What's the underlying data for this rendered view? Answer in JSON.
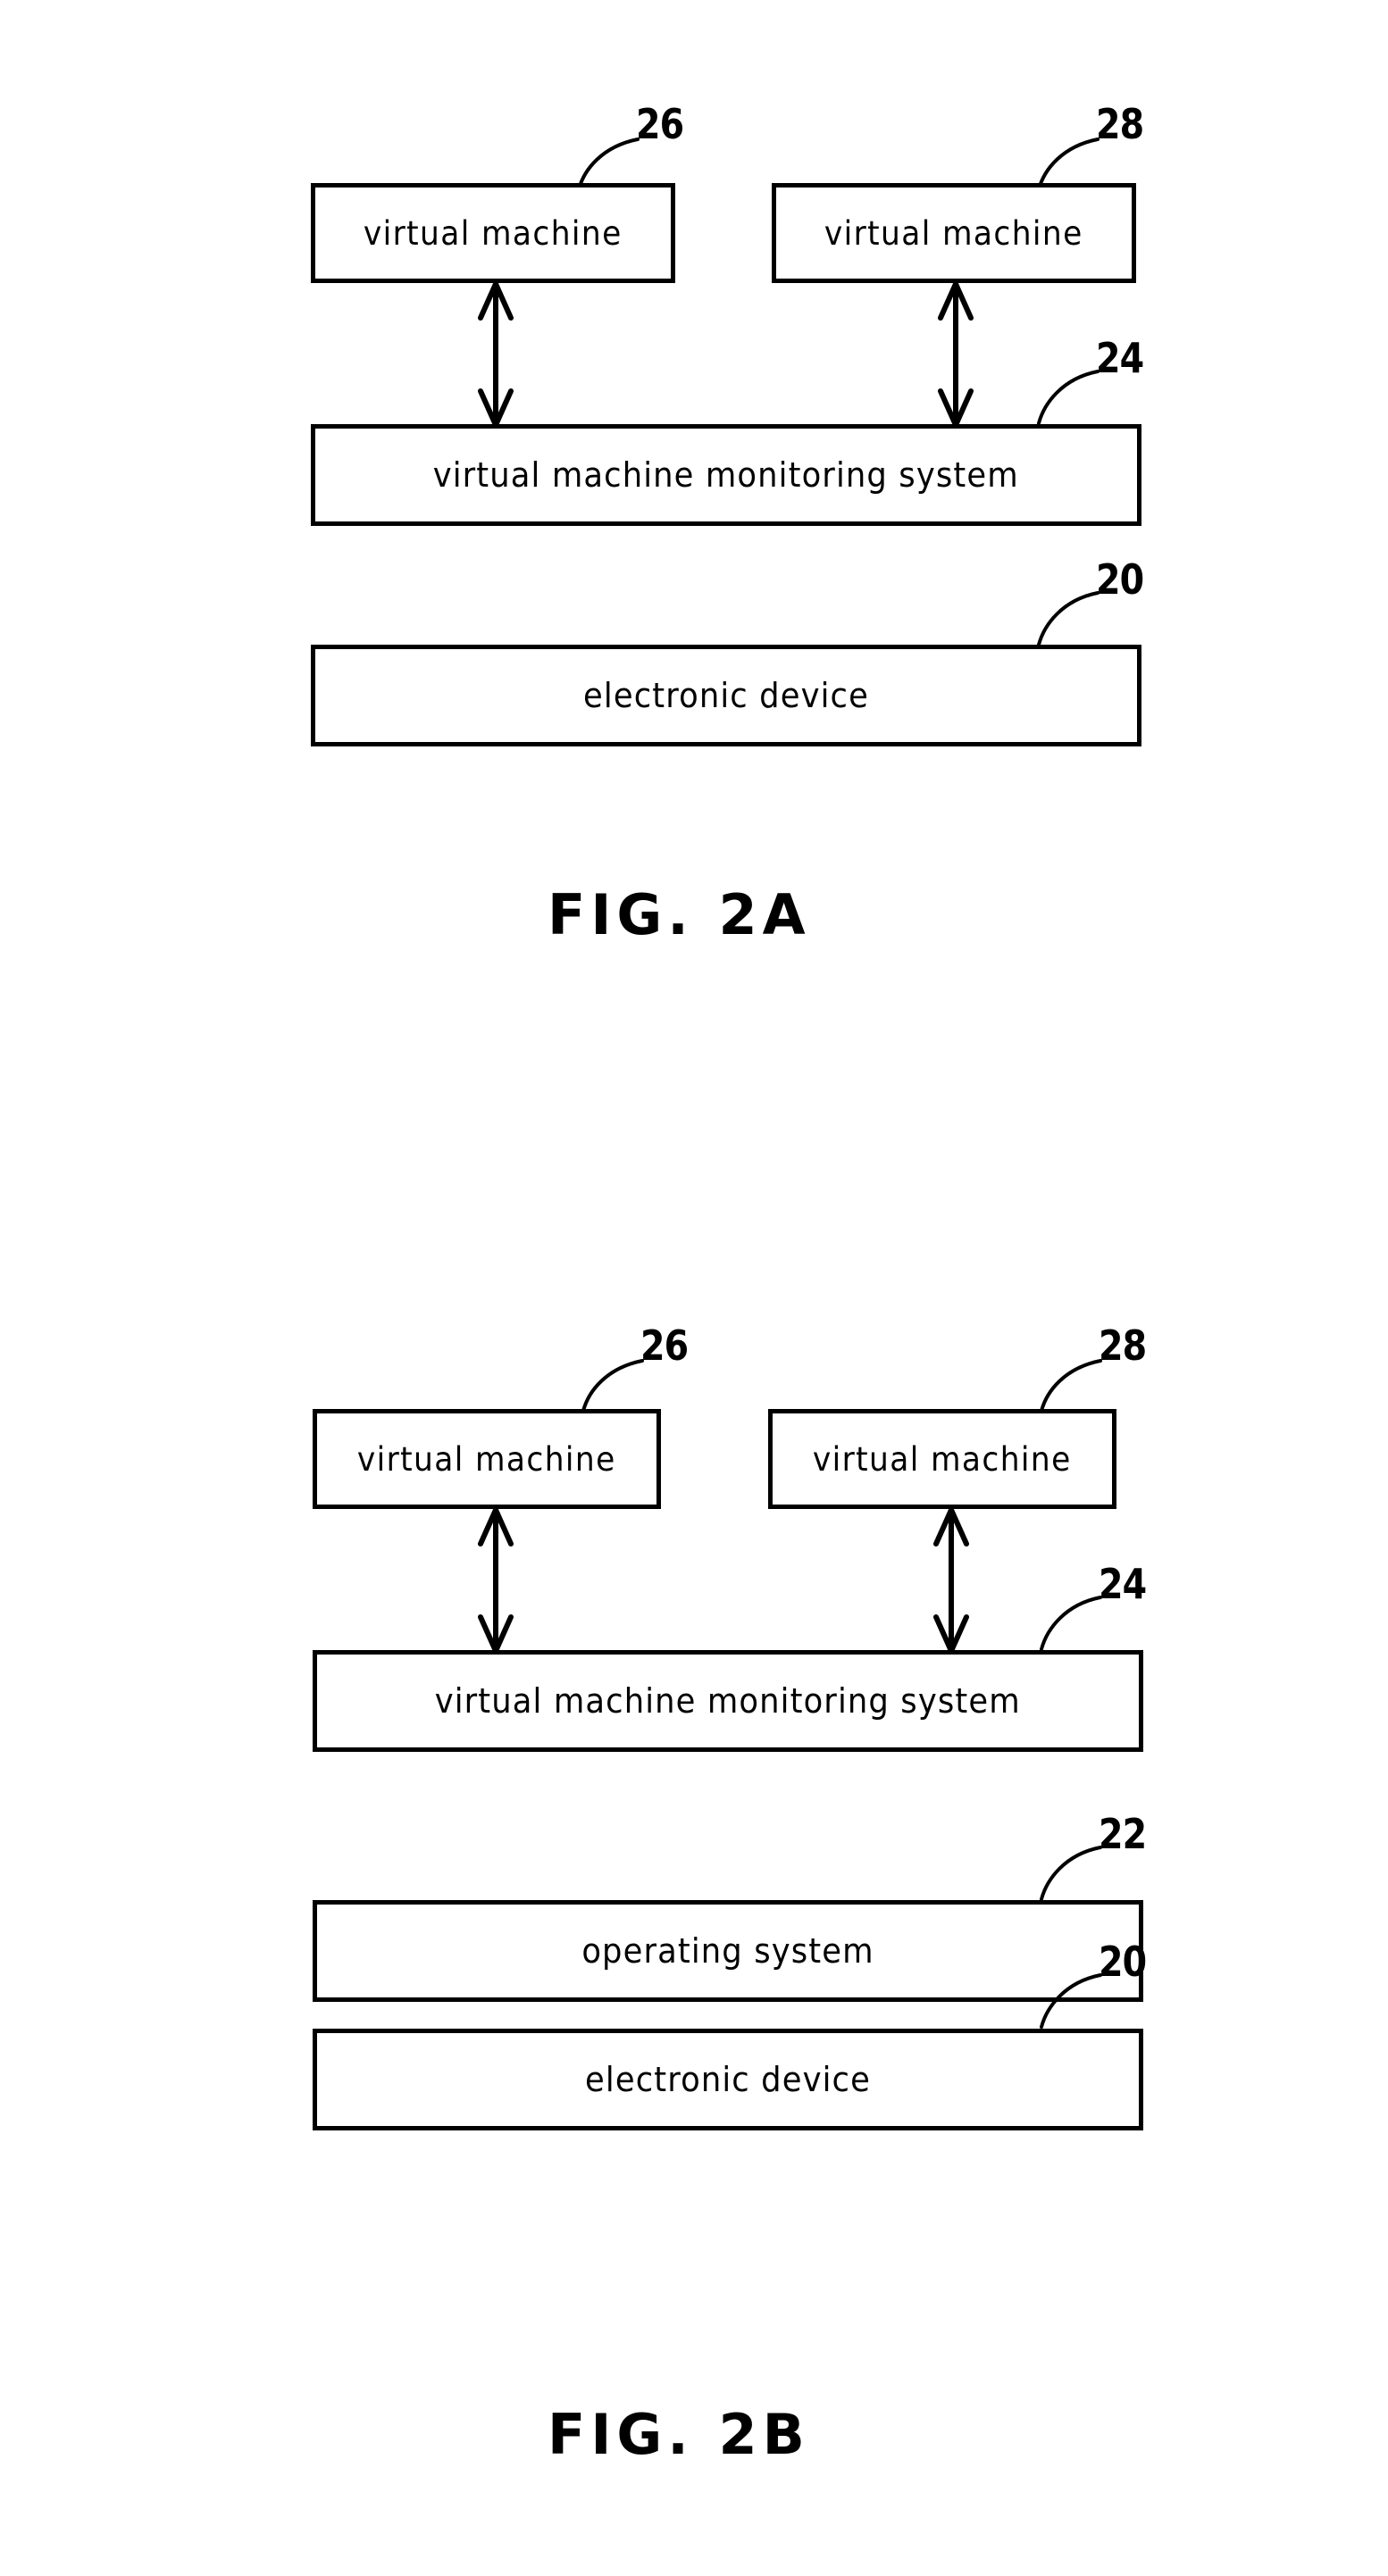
{
  "document": {
    "type": "patent-drawing-sheet",
    "background_color": "#ffffff",
    "line_color": "#000000"
  },
  "figures": [
    {
      "id": "fig-2a",
      "caption": "FIG. 2A",
      "boxes": [
        {
          "id": "vm-left",
          "label": "virtual machine",
          "ref": "26"
        },
        {
          "id": "vm-right",
          "label": "virtual machine",
          "ref": "28"
        },
        {
          "id": "monitor",
          "label": "virtual machine monitoring system",
          "ref": "24"
        },
        {
          "id": "device",
          "label": "electronic device",
          "ref": "20"
        }
      ],
      "connectors": [
        {
          "from": "vm-left",
          "to": "monitor",
          "kind": "double-arrow"
        },
        {
          "from": "vm-right",
          "to": "monitor",
          "kind": "double-arrow"
        }
      ]
    },
    {
      "id": "fig-2b",
      "caption": "FIG. 2B",
      "boxes": [
        {
          "id": "vm-left",
          "label": "virtual machine",
          "ref": "26"
        },
        {
          "id": "vm-right",
          "label": "virtual machine",
          "ref": "28"
        },
        {
          "id": "monitor",
          "label": "virtual machine monitoring system",
          "ref": "24"
        },
        {
          "id": "os",
          "label": "operating system",
          "ref": "22"
        },
        {
          "id": "device",
          "label": "electronic device",
          "ref": "20"
        }
      ],
      "connectors": [
        {
          "from": "vm-left",
          "to": "monitor",
          "kind": "double-arrow"
        },
        {
          "from": "vm-right",
          "to": "monitor",
          "kind": "double-arrow"
        }
      ]
    }
  ],
  "fig2a": {
    "caption": "FIG. 2A",
    "vm_left_label": "virtual machine",
    "vm_left_ref": "26",
    "vm_right_label": "virtual machine",
    "vm_right_ref": "28",
    "monitor_label": "virtual machine monitoring system",
    "monitor_ref": "24",
    "device_label": "electronic device",
    "device_ref": "20"
  },
  "fig2b": {
    "caption": "FIG. 2B",
    "vm_left_label": "virtual machine",
    "vm_left_ref": "26",
    "vm_right_label": "virtual machine",
    "vm_right_ref": "28",
    "monitor_label": "virtual machine monitoring system",
    "monitor_ref": "24",
    "os_label": "operating system",
    "os_ref": "22",
    "device_label": "electronic device",
    "device_ref": "20"
  }
}
